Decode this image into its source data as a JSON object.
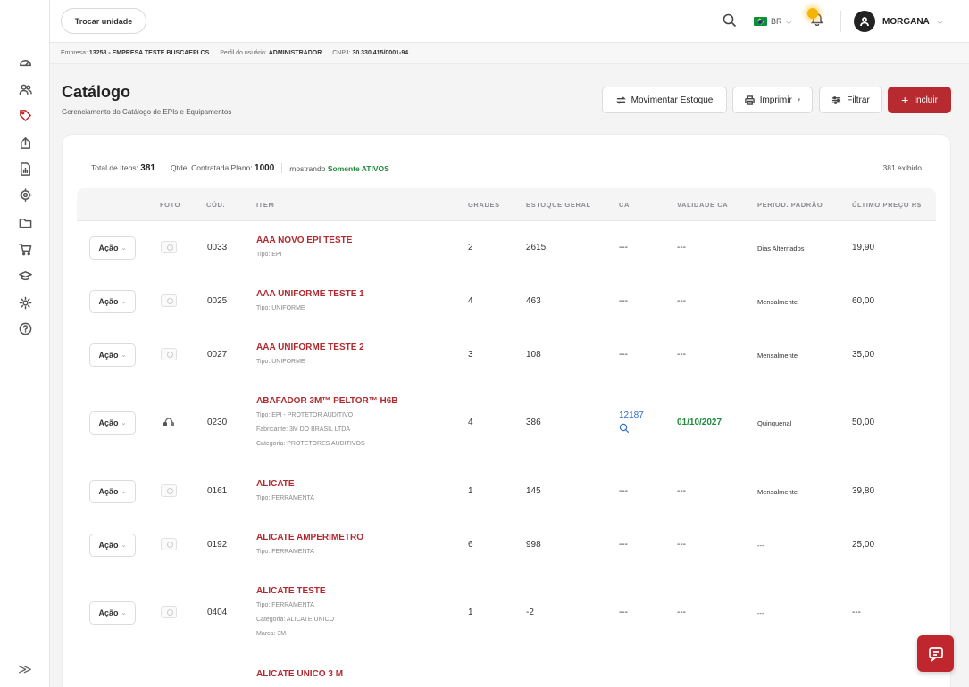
{
  "topbar": {
    "switch_unit_label": "Trocar unidade",
    "lang": "BR",
    "user": "MORGANA"
  },
  "infobar": {
    "empresa_label": "Empresa:",
    "empresa_value": "13258 - EMPRESA TESTE BUSCAEPI CS",
    "perfil_label": "Perfil do usuário:",
    "perfil_value": "ADMINISTRADOR",
    "cnpj_label": "CNPJ:",
    "cnpj_value": "30.330.415/0001-94"
  },
  "page": {
    "title": "Catálogo",
    "subtitle": "Gerenciamento do Catálogo de EPIs e Equipamentos"
  },
  "actions": {
    "movimentar": "Movimentar Estoque",
    "imprimir": "Imprimir",
    "filtrar": "Filtrar",
    "incluir": "Incluir"
  },
  "summary": {
    "total_label": "Total de Itens:",
    "total_value": "381",
    "contratada_label": "Qtde. Contratada Plano:",
    "contratada_value": "1000",
    "mostrando_label": "mostrando",
    "mostrando_value": "Somente ATIVOS",
    "exibido": "381 exibido"
  },
  "table": {
    "headers": {
      "foto": "FOTO",
      "cod": "CÓD.",
      "item": "ITEM",
      "grades": "GRADES",
      "estoque": "ESTOQUE GERAL",
      "ca": "CA",
      "validade": "VALIDADE CA",
      "period": "PERIOD. PADRÃO",
      "preco": "ÚLTIMO PREÇO R$"
    },
    "acao_label": "Ação",
    "rows": [
      {
        "cod": "0033",
        "name": "AAA NOVO EPI TESTE",
        "sub": [
          "Tipo: EPI"
        ],
        "grades": "2",
        "estoque": "2615",
        "ca": "---",
        "validade": "---",
        "period": "Dias Alternados",
        "preco": "19,90"
      },
      {
        "cod": "0025",
        "name": "AAA UNIFORME TESTE 1",
        "sub": [
          "Tipo: UNIFORME"
        ],
        "grades": "4",
        "estoque": "463",
        "ca": "---",
        "validade": "---",
        "period": "Mensalmente",
        "preco": "60,00"
      },
      {
        "cod": "0027",
        "name": "AAA UNIFORME TESTE 2",
        "sub": [
          "Tipo: UNIFORME"
        ],
        "grades": "3",
        "estoque": "108",
        "ca": "---",
        "validade": "---",
        "period": "Mensalmente",
        "preco": "35,00"
      },
      {
        "cod": "0230",
        "name": "ABAFADOR 3M™ PELTOR™ H6B",
        "sub": [
          "Tipo: EPI - PROTETOR AUDITIVO",
          "Fabricante: 3M DO BRASIL LTDA",
          "Categoria: PROTETORES AUDITIVOS"
        ],
        "grades": "4",
        "estoque": "386",
        "ca": "12187",
        "validade": "01/10/2027",
        "period": "Quinquenal",
        "preco": "50,00"
      },
      {
        "cod": "0161",
        "name": "ALICATE",
        "sub": [
          "Tipo: FERRAMENTA"
        ],
        "grades": "1",
        "estoque": "145",
        "ca": "---",
        "validade": "---",
        "period": "Mensalmente",
        "preco": "39,80"
      },
      {
        "cod": "0192",
        "name": "ALICATE AMPERIMETRO",
        "sub": [
          "Tipo: FERRAMENTA"
        ],
        "grades": "6",
        "estoque": "998",
        "ca": "---",
        "validade": "---",
        "period": "---",
        "preco": "25,00"
      },
      {
        "cod": "0404",
        "name": "ALICATE TESTE",
        "sub": [
          "Tipo: FERRAMENTA",
          "Categoria: ALICATE UNICO",
          "Marca: 3M"
        ],
        "grades": "1",
        "estoque": "-2",
        "ca": "---",
        "validade": "---",
        "period": "---",
        "preco": "---"
      },
      {
        "name": "ALICATE UNICO 3 M"
      }
    ]
  }
}
